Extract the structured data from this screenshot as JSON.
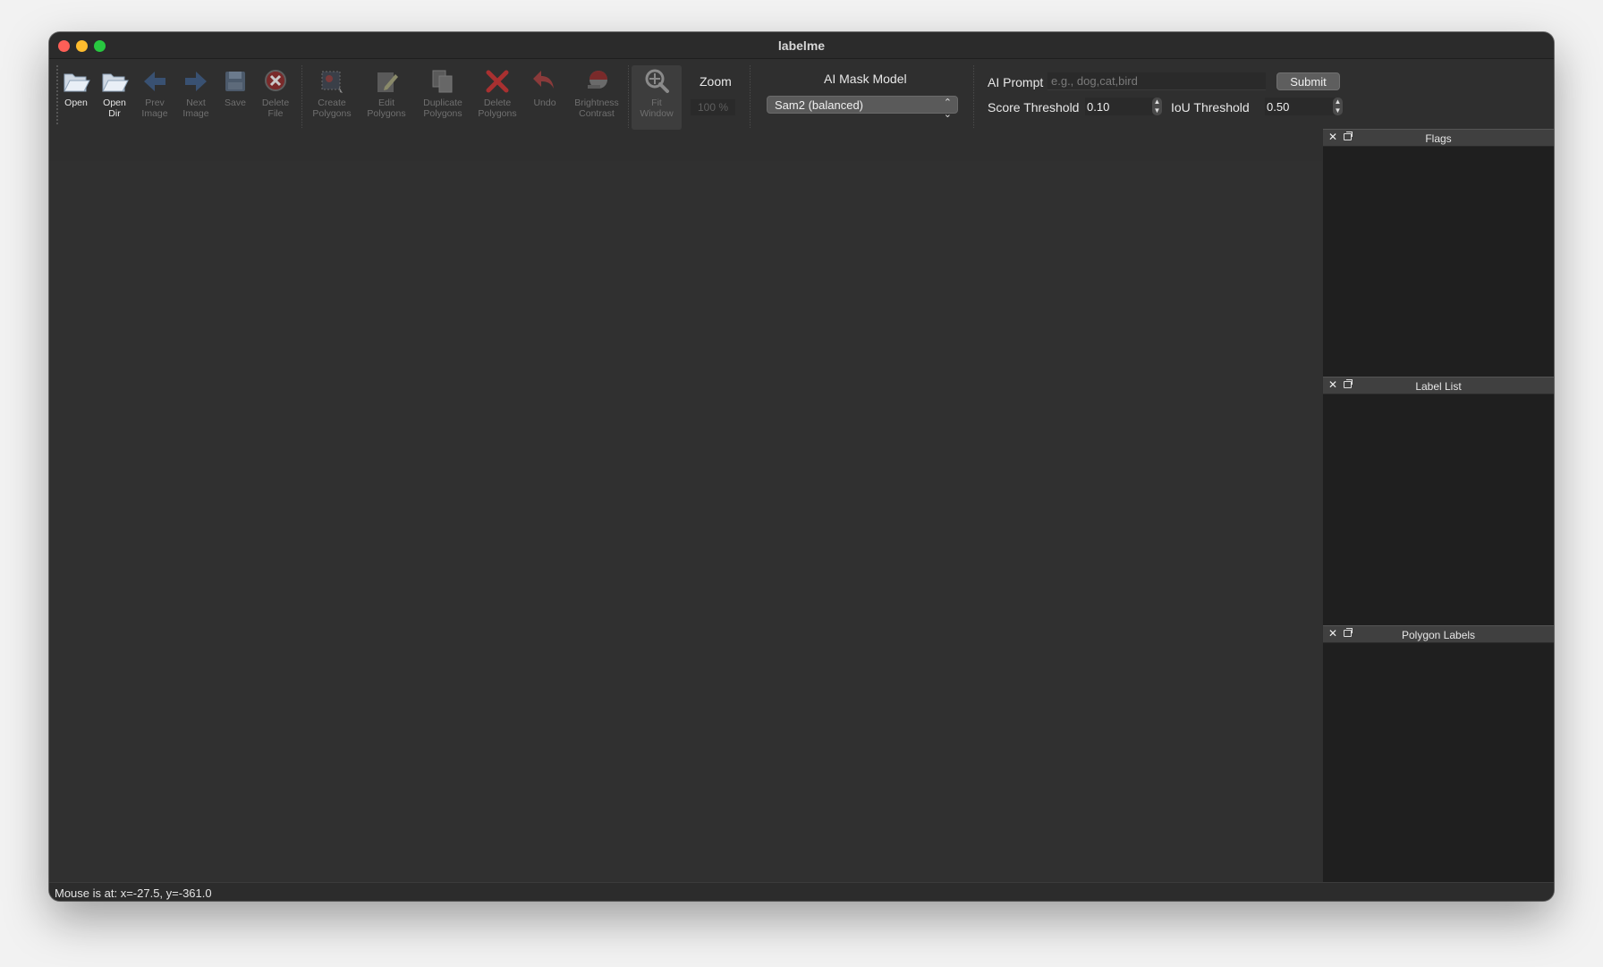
{
  "window": {
    "title": "labelme"
  },
  "toolbar": {
    "open": "Open",
    "open_dir": [
      "Open",
      "Dir"
    ],
    "prev_image": [
      "Prev",
      "Image"
    ],
    "next_image": [
      "Next",
      "Image"
    ],
    "save": "Save",
    "delete_file": [
      "Delete",
      "File"
    ],
    "create_polygons": [
      "Create",
      "Polygons"
    ],
    "edit_polygons": [
      "Edit",
      "Polygons"
    ],
    "duplicate_polygons": [
      "Duplicate",
      "Polygons"
    ],
    "delete_polygons": [
      "Delete",
      "Polygons"
    ],
    "undo": "Undo",
    "brightness_contrast": [
      "Brightness",
      "Contrast"
    ],
    "fit_window": [
      "Fit",
      "Window"
    ],
    "zoom_label": "Zoom",
    "zoom_value": "100 %"
  },
  "ai": {
    "mask_model_label": "AI Mask Model",
    "mask_model_selected": "Sam2 (balanced)",
    "prompt_label": "AI Prompt",
    "prompt_placeholder": "e.g., dog,cat,bird",
    "submit": "Submit",
    "score_threshold_label": "Score Threshold",
    "score_threshold_value": "0.10",
    "iou_threshold_label": "IoU Threshold",
    "iou_threshold_value": "0.50"
  },
  "docks": {
    "flags": "Flags",
    "label_list": "Label List",
    "polygon_labels": "Polygon Labels"
  },
  "status": {
    "mouse": "Mouse is at: x=-27.5, y=-361.0"
  },
  "icons": [
    "folder-open-icon",
    "folder-dir-icon",
    "arrow-left-icon",
    "arrow-right-icon",
    "save-icon",
    "delete-circle-icon",
    "create-polygon-icon",
    "edit-icon",
    "duplicate-icon",
    "delete-x-icon",
    "undo-icon",
    "brightness-icon",
    "fit-window-icon"
  ],
  "colors": {
    "window_bg": "#2f2f2f",
    "dock_bg": "#1f1f1f",
    "accent_red": "#d9534f",
    "accent_blue": "#4a7fc1"
  }
}
